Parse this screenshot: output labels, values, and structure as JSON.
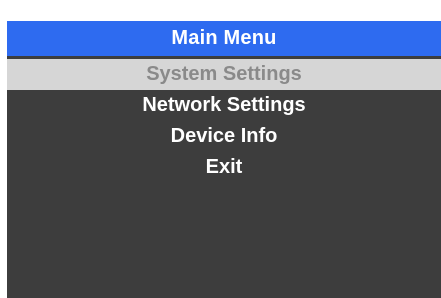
{
  "menu": {
    "title": "Main Menu",
    "selected_index": 0,
    "items": [
      {
        "label": "System Settings"
      },
      {
        "label": "Network Settings"
      },
      {
        "label": "Device Info"
      },
      {
        "label": "Exit"
      }
    ]
  },
  "colors": {
    "header_background": "#2e6bf0",
    "panel_background": "#3d3d3d",
    "selected_background": "#d6d6d6",
    "selected_text": "#8a8a8a",
    "text": "#ffffff"
  }
}
